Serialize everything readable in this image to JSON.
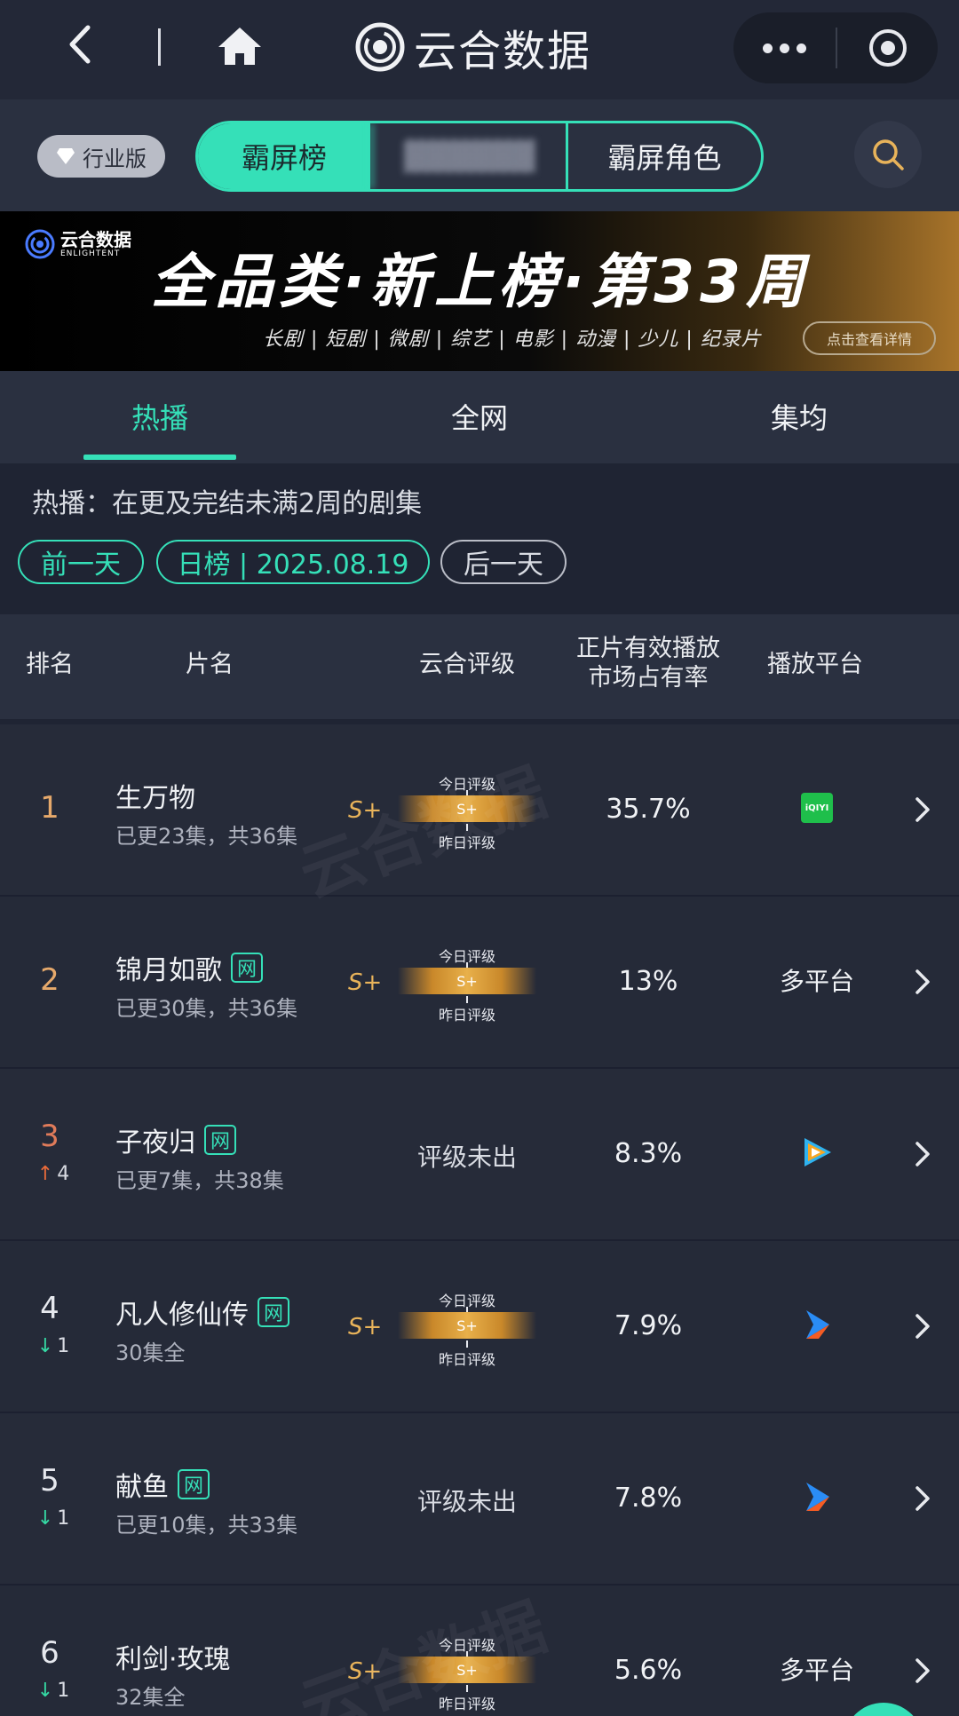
{
  "nav": {
    "title": "云合数据",
    "back_icon": "chevron-left-icon",
    "home_icon": "home-icon"
  },
  "subbar": {
    "industry_label": "行业版",
    "segments": [
      "霸屏榜",
      "霸屏角色"
    ],
    "accent": "#35e0b8"
  },
  "banner": {
    "logo_cn": "云合数据",
    "logo_en": "ENLIGHTENT",
    "title": "全品类·新上榜·第33周",
    "categories": "长剧 | 短剧 | 微剧 | 综艺 | 电影 | 动漫 | 少儿 | 纪录片",
    "button": "点击查看详情"
  },
  "tabs": [
    "热播",
    "全网",
    "集均"
  ],
  "description": "热播：在更及完结未满2周的剧集",
  "date": {
    "prev": "前一天",
    "current": "日榜 | 2025.08.19",
    "next": "后一天"
  },
  "table": {
    "headers": {
      "rank": "排名",
      "title": "片名",
      "rating": "云合评级",
      "share_line1": "正片有效播放",
      "share_line2": "市场占有率",
      "platform": "播放平台"
    },
    "today_label": "今日评级",
    "yesterday_label": "昨日评级",
    "rows": [
      {
        "rank": "1",
        "name": "生万物",
        "net": "",
        "episodes": "已更23集，共36集",
        "grade": "S+",
        "bar_grade": "S+",
        "rating_text": "",
        "share": "35.7%",
        "platform": "",
        "platform_icon": "iqiyi",
        "trend": "",
        "trend_num": ""
      },
      {
        "rank": "2",
        "name": "锦月如歌",
        "net": "网",
        "episodes": "已更30集，共36集",
        "grade": "S+",
        "bar_grade": "S+",
        "rating_text": "",
        "share": "13%",
        "platform": "多平台",
        "platform_icon": "",
        "trend": "",
        "trend_num": ""
      },
      {
        "rank": "3",
        "name": "子夜归",
        "net": "网",
        "episodes": "已更7集，共38集",
        "grade": "",
        "bar_grade": "",
        "rating_text": "评级未出",
        "share": "8.3%",
        "platform": "",
        "platform_icon": "tencent",
        "trend": "up",
        "trend_num": "4"
      },
      {
        "rank": "4",
        "name": "凡人修仙传",
        "net": "网",
        "episodes": "30集全",
        "grade": "S+",
        "bar_grade": "S+",
        "rating_text": "",
        "share": "7.9%",
        "platform": "",
        "platform_icon": "youku",
        "trend": "down",
        "trend_num": "1"
      },
      {
        "rank": "5",
        "name": "献鱼",
        "net": "网",
        "episodes": "已更10集，共33集",
        "grade": "",
        "bar_grade": "",
        "rating_text": "评级未出",
        "share": "7.8%",
        "platform": "",
        "platform_icon": "youku",
        "trend": "down",
        "trend_num": "1"
      },
      {
        "rank": "6",
        "name": "利剑·玫瑰",
        "net": "",
        "episodes": "32集全",
        "grade": "S+",
        "bar_grade": "S+",
        "rating_text": "",
        "share": "5.6%",
        "platform": "多平台",
        "platform_icon": "",
        "trend": "down",
        "trend_num": "1"
      }
    ]
  },
  "watermark": "云合数据"
}
